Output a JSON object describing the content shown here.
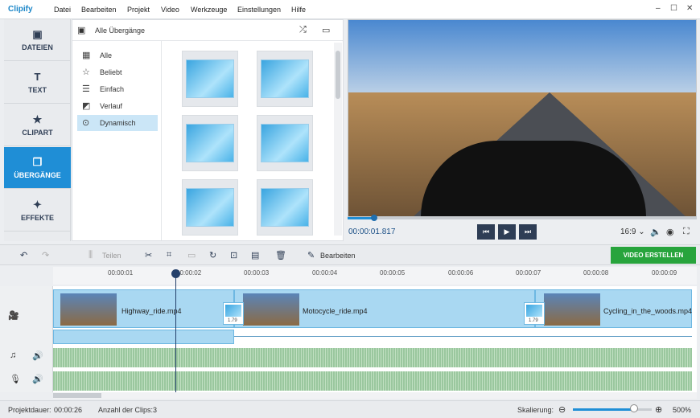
{
  "app": {
    "logo": "Clipify"
  },
  "menu": [
    "Datei",
    "Bearbeiten",
    "Projekt",
    "Video",
    "Werkzeuge",
    "Einstellungen",
    "Hilfe"
  ],
  "window_controls": {
    "minimize": "–",
    "maximize": "☐",
    "close": "✕"
  },
  "sidebar": {
    "items": [
      {
        "label": "DATEIEN",
        "icon": "image-icon",
        "glyph": "▣"
      },
      {
        "label": "TEXT",
        "icon": "text-icon",
        "glyph": "T"
      },
      {
        "label": "CLIPART",
        "icon": "star-icon",
        "glyph": "★"
      },
      {
        "label": "ÜBERGÄNGE",
        "icon": "transitions-icon",
        "glyph": "❐",
        "active": true
      },
      {
        "label": "EFFEKTE",
        "icon": "magic-wand-icon",
        "glyph": "✦"
      }
    ]
  },
  "panel": {
    "header": "Alle Übergänge",
    "categories": [
      {
        "label": "Alle",
        "icon": "grid-icon",
        "glyph": "▦"
      },
      {
        "label": "Beliebt",
        "icon": "star-outline-icon",
        "glyph": "☆"
      },
      {
        "label": "Einfach",
        "icon": "list-icon",
        "glyph": "☰"
      },
      {
        "label": "Verlauf",
        "icon": "gradient-icon",
        "glyph": "◩"
      },
      {
        "label": "Dynamisch",
        "icon": "play-circle-icon",
        "glyph": "⊙",
        "active": true
      }
    ]
  },
  "player": {
    "timecode": "00:00:01.817",
    "ratio": "16:9 ⌄",
    "progress_percent": 7.6,
    "buttons": {
      "prev": "⏮",
      "play": "▶",
      "next": "⏭"
    }
  },
  "toolbar": {
    "split_label": "Teilen",
    "edit_label": "Bearbeiten",
    "create_label": "VIDEO ERSTELLEN"
  },
  "ruler": [
    "00:00:01",
    "00:00:02",
    "00:00:03",
    "00:00:04",
    "00:00:05",
    "00:00:06",
    "00:00:07",
    "00:00:08",
    "00:00:09"
  ],
  "clips": [
    {
      "name": "Highway_ride.mp4"
    },
    {
      "name": "Motocycle_ride.mp4"
    },
    {
      "name": "Cycling_in_the_woods.mp4"
    }
  ],
  "transitions": [
    {
      "value": "1.79"
    },
    {
      "value": "1.79"
    }
  ],
  "status": {
    "duration_label": "Projektdauer:",
    "duration": "00:00:26",
    "clips_label": "Anzahl der Clips:",
    "clips": "3",
    "scale_label": "Skalierung:",
    "scale": "500%",
    "scale_fraction": 0.78
  },
  "colors": {
    "accent": "#1f8ed6",
    "create": "#27a43c",
    "dark": "#2e3d55"
  }
}
